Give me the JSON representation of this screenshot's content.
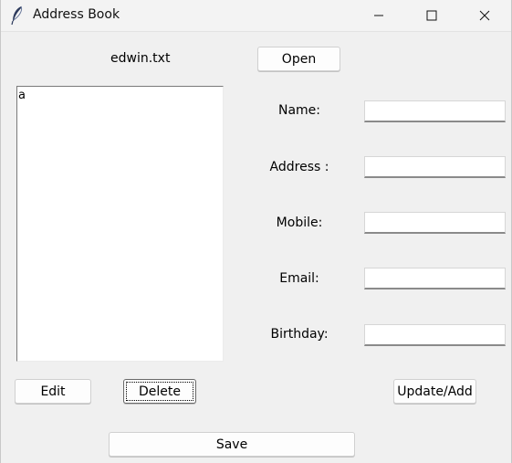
{
  "window": {
    "title": "Address Book",
    "icon": "feather-icon"
  },
  "file": {
    "name": "edwin.txt",
    "open_label": "Open"
  },
  "list": {
    "items": [
      "a"
    ]
  },
  "form": {
    "name_label": "Name:",
    "address_label": "Address :",
    "mobile_label": "Mobile:",
    "email_label": "Email:",
    "birthday_label": "Birthday:",
    "name_value": "",
    "address_value": "",
    "mobile_value": "",
    "email_value": "",
    "birthday_value": ""
  },
  "actions": {
    "edit_label": "Edit",
    "delete_label": "Delete",
    "update_label": "Update/Add",
    "save_label": "Save"
  },
  "colors": {
    "background": "#f0f0f0",
    "entry_underline": "#8a8a8a"
  }
}
